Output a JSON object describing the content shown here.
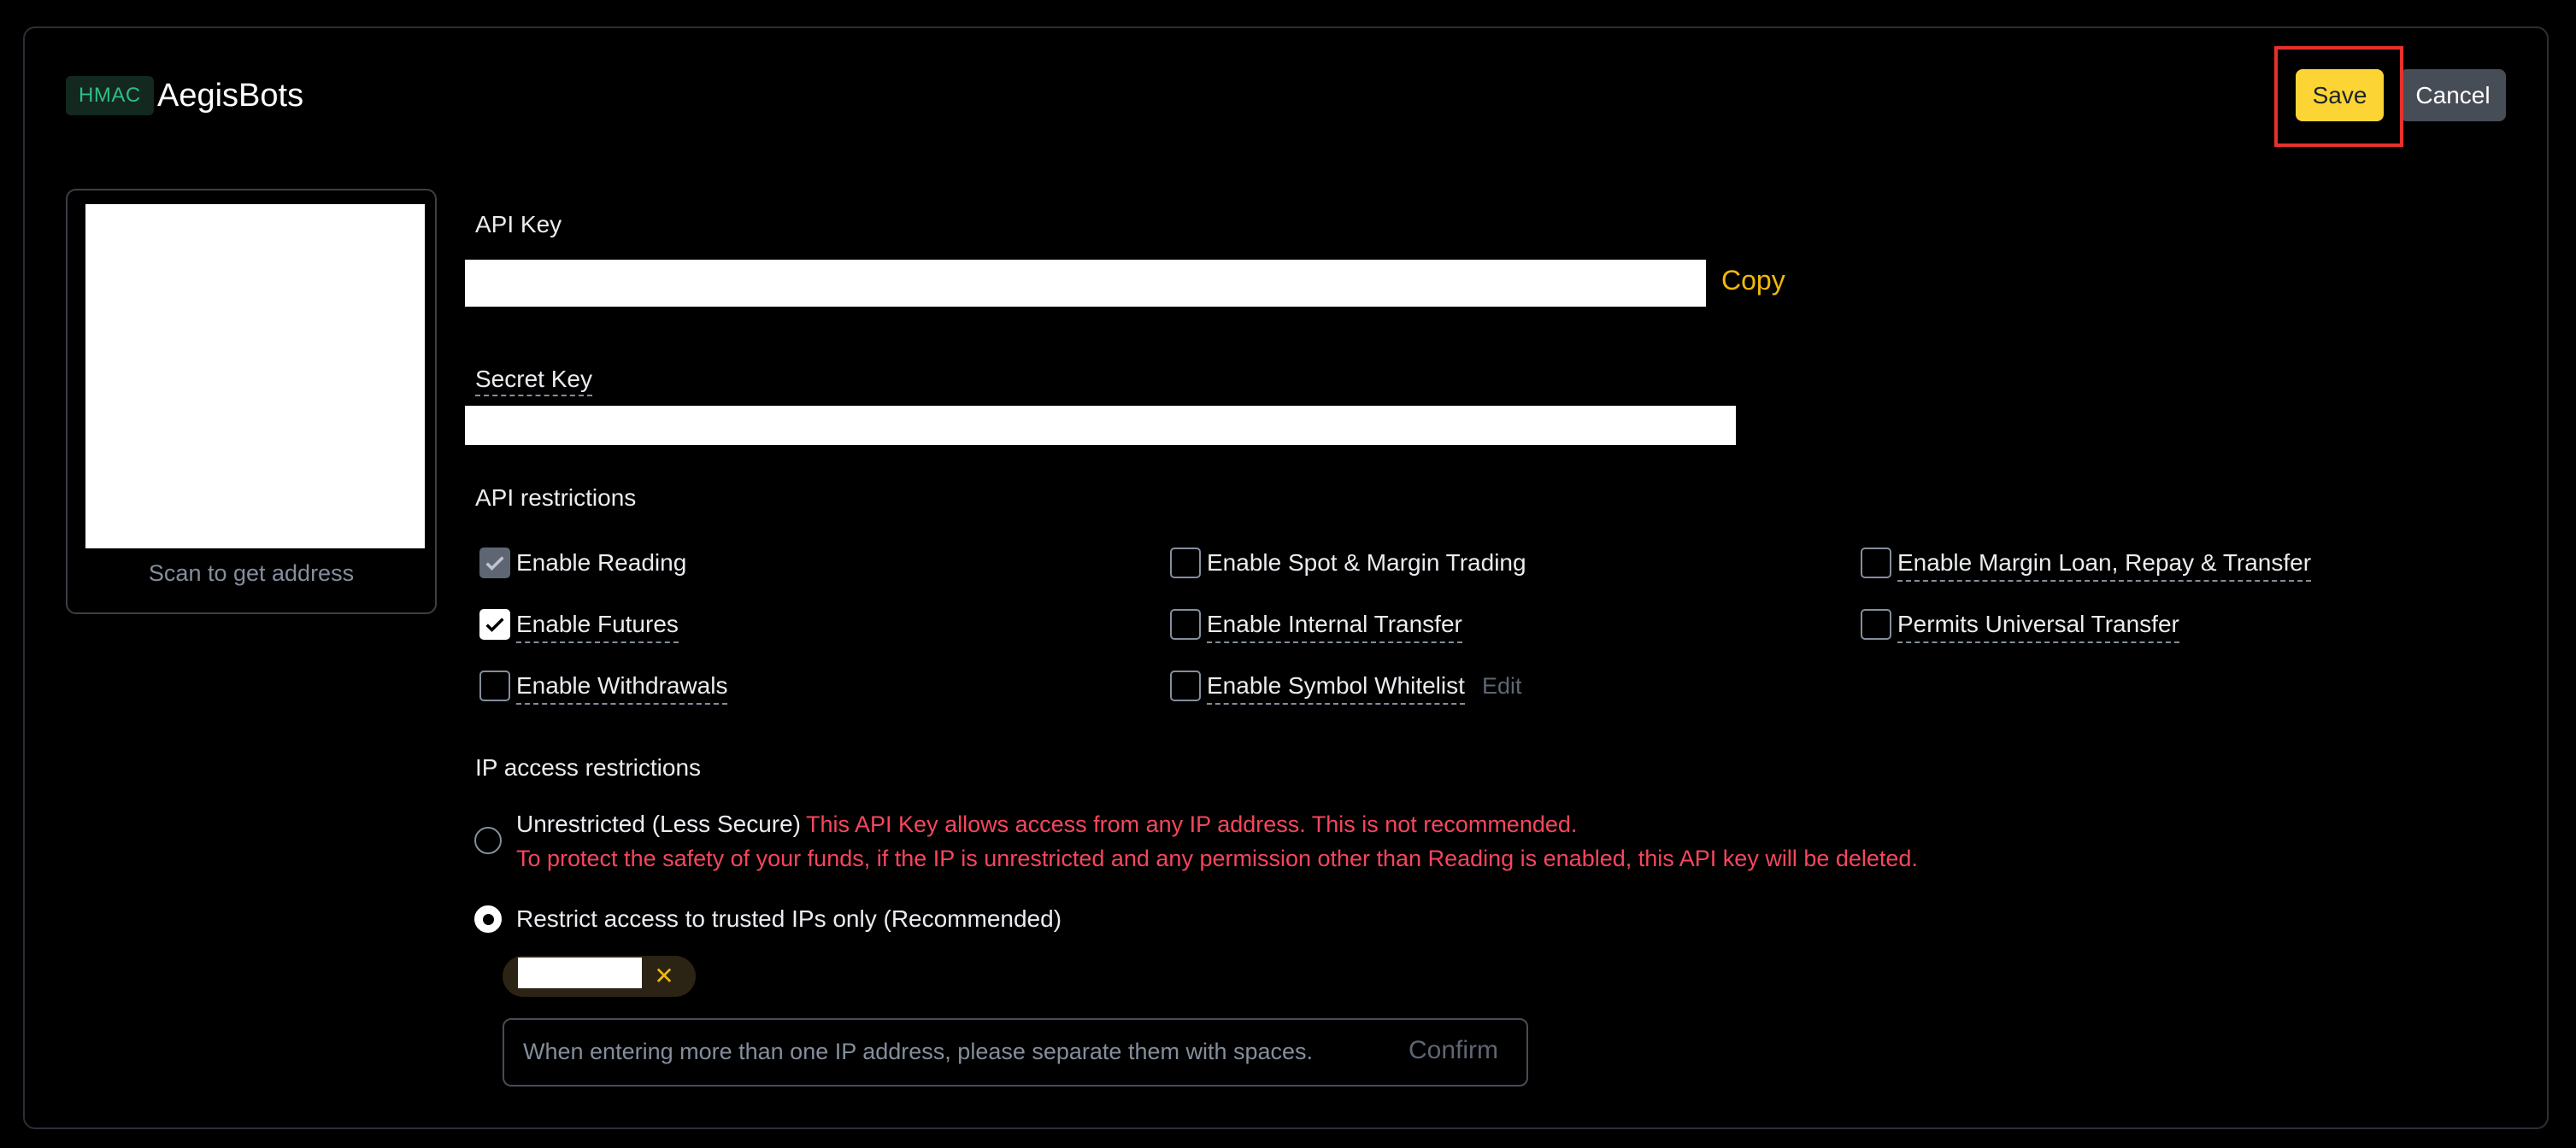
{
  "header": {
    "badge": "HMAC",
    "title": "AegisBots",
    "save_label": "Save",
    "cancel_label": "Cancel"
  },
  "qr": {
    "caption": "Scan to get address"
  },
  "api_key": {
    "label": "API Key",
    "copy_label": "Copy"
  },
  "secret_key": {
    "label": "Secret Key"
  },
  "restrictions": {
    "title": "API restrictions",
    "items": [
      {
        "label": "Enable Reading",
        "checked": true,
        "disabled": true
      },
      {
        "label": "Enable Spot & Margin Trading",
        "checked": false
      },
      {
        "label": "Enable Margin Loan, Repay & Transfer",
        "checked": false
      },
      {
        "label": "Enable Futures",
        "checked": true
      },
      {
        "label": "Enable Internal Transfer",
        "checked": false
      },
      {
        "label": "Permits Universal Transfer",
        "checked": false
      },
      {
        "label": "Enable Withdrawals",
        "checked": false
      },
      {
        "label": "Enable Symbol Whitelist",
        "checked": false
      }
    ],
    "edit_label": "Edit"
  },
  "ip_access": {
    "title": "IP access restrictions",
    "unrestricted_label": "Unrestricted (Less Secure)",
    "unrestricted_warning_1": "This API Key allows access from any IP address. This is not recommended.",
    "unrestricted_warning_2": "To protect the safety of your funds, if the IP is unrestricted and any permission other than Reading is enabled, this API key will be deleted.",
    "restricted_label": "Restrict access to trusted IPs only (Recommended)",
    "selected": "restricted",
    "input_placeholder": "When entering more than one IP address, please separate them with spaces.",
    "confirm_label": "Confirm"
  },
  "colors": {
    "accent": "#fcd535",
    "link": "#f0b90b",
    "warning": "#f6465d",
    "badge_text": "#2ebd85",
    "highlight_box": "#e7312b"
  }
}
